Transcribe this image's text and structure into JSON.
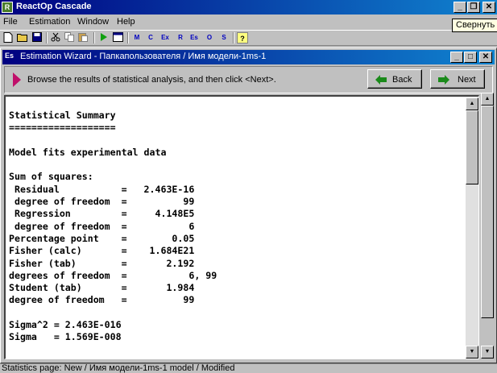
{
  "app": {
    "title": "ReactOp Cascade",
    "icon_glyph": "R",
    "min_glyph": "_",
    "max_glyph": "❐",
    "close_glyph": "✕",
    "tooltip": "Свернуть"
  },
  "menu": {
    "file": "File",
    "estimation": "Estimation",
    "window": "Window",
    "help": "Help"
  },
  "toolbar": {
    "letters": [
      "M",
      "C",
      "Ex",
      "R",
      "Es",
      "O",
      "S"
    ],
    "help_glyph": "?"
  },
  "wizard": {
    "icon_label": "Es",
    "title": "Estimation Wizard - Папкапользователя / Имя модели-1ms-1",
    "min_glyph": "_",
    "max_glyph": "□",
    "close_glyph": "✕",
    "instruction": "Browse the results of statistical analysis, and then click <Next>.",
    "back_label": "Back",
    "next_label": "Next",
    "back_arrow": "◆",
    "next_arrow": "◆"
  },
  "results": {
    "text": "Statistical Summary\n===================\n\nModel fits experimental data\n\nSum of squares:\n Residual           =   2.463E-16\n degree of freedom  =          99\n Regression         =     4.148E5\n degree of freedom  =           6\nPercentage point    =        0.05\nFisher (calc)       =    1.684E21\nFisher (tab)        =       2.192\ndegrees of freedom  =           6, 99\nStudent (tab)       =       1.984\ndegree of freedom   =          99\n\nSigma^2 = 2.463E-016\nSigma   = 1.569E-008"
  },
  "scroll": {
    "up_glyph": "▲",
    "down_glyph": "▼"
  },
  "status": {
    "text": "Statistics page: New / Имя модели-1ms-1 model / Modified"
  },
  "colors": {
    "titlebar_start": "#000080",
    "titlebar_end": "#1084d0",
    "instruction_arrow": "#c0106a",
    "nav_arrow": "#1a8a1a"
  }
}
